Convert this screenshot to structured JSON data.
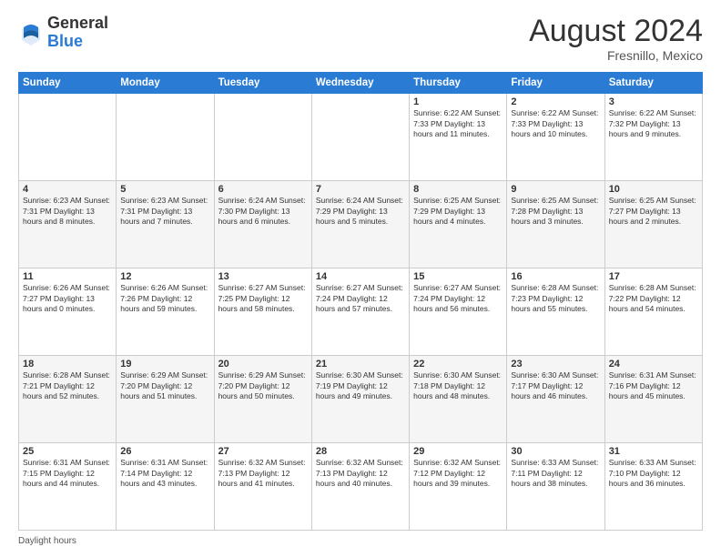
{
  "logo": {
    "general": "General",
    "blue": "Blue"
  },
  "header": {
    "month_year": "August 2024",
    "location": "Fresnillo, Mexico"
  },
  "days_of_week": [
    "Sunday",
    "Monday",
    "Tuesday",
    "Wednesday",
    "Thursday",
    "Friday",
    "Saturday"
  ],
  "footer": {
    "label": "Daylight hours"
  },
  "weeks": [
    [
      {
        "day": "",
        "info": ""
      },
      {
        "day": "",
        "info": ""
      },
      {
        "day": "",
        "info": ""
      },
      {
        "day": "",
        "info": ""
      },
      {
        "day": "1",
        "info": "Sunrise: 6:22 AM\nSunset: 7:33 PM\nDaylight: 13 hours\nand 11 minutes."
      },
      {
        "day": "2",
        "info": "Sunrise: 6:22 AM\nSunset: 7:33 PM\nDaylight: 13 hours\nand 10 minutes."
      },
      {
        "day": "3",
        "info": "Sunrise: 6:22 AM\nSunset: 7:32 PM\nDaylight: 13 hours\nand 9 minutes."
      }
    ],
    [
      {
        "day": "4",
        "info": "Sunrise: 6:23 AM\nSunset: 7:31 PM\nDaylight: 13 hours\nand 8 minutes."
      },
      {
        "day": "5",
        "info": "Sunrise: 6:23 AM\nSunset: 7:31 PM\nDaylight: 13 hours\nand 7 minutes."
      },
      {
        "day": "6",
        "info": "Sunrise: 6:24 AM\nSunset: 7:30 PM\nDaylight: 13 hours\nand 6 minutes."
      },
      {
        "day": "7",
        "info": "Sunrise: 6:24 AM\nSunset: 7:29 PM\nDaylight: 13 hours\nand 5 minutes."
      },
      {
        "day": "8",
        "info": "Sunrise: 6:25 AM\nSunset: 7:29 PM\nDaylight: 13 hours\nand 4 minutes."
      },
      {
        "day": "9",
        "info": "Sunrise: 6:25 AM\nSunset: 7:28 PM\nDaylight: 13 hours\nand 3 minutes."
      },
      {
        "day": "10",
        "info": "Sunrise: 6:25 AM\nSunset: 7:27 PM\nDaylight: 13 hours\nand 2 minutes."
      }
    ],
    [
      {
        "day": "11",
        "info": "Sunrise: 6:26 AM\nSunset: 7:27 PM\nDaylight: 13 hours\nand 0 minutes."
      },
      {
        "day": "12",
        "info": "Sunrise: 6:26 AM\nSunset: 7:26 PM\nDaylight: 12 hours\nand 59 minutes."
      },
      {
        "day": "13",
        "info": "Sunrise: 6:27 AM\nSunset: 7:25 PM\nDaylight: 12 hours\nand 58 minutes."
      },
      {
        "day": "14",
        "info": "Sunrise: 6:27 AM\nSunset: 7:24 PM\nDaylight: 12 hours\nand 57 minutes."
      },
      {
        "day": "15",
        "info": "Sunrise: 6:27 AM\nSunset: 7:24 PM\nDaylight: 12 hours\nand 56 minutes."
      },
      {
        "day": "16",
        "info": "Sunrise: 6:28 AM\nSunset: 7:23 PM\nDaylight: 12 hours\nand 55 minutes."
      },
      {
        "day": "17",
        "info": "Sunrise: 6:28 AM\nSunset: 7:22 PM\nDaylight: 12 hours\nand 54 minutes."
      }
    ],
    [
      {
        "day": "18",
        "info": "Sunrise: 6:28 AM\nSunset: 7:21 PM\nDaylight: 12 hours\nand 52 minutes."
      },
      {
        "day": "19",
        "info": "Sunrise: 6:29 AM\nSunset: 7:20 PM\nDaylight: 12 hours\nand 51 minutes."
      },
      {
        "day": "20",
        "info": "Sunrise: 6:29 AM\nSunset: 7:20 PM\nDaylight: 12 hours\nand 50 minutes."
      },
      {
        "day": "21",
        "info": "Sunrise: 6:30 AM\nSunset: 7:19 PM\nDaylight: 12 hours\nand 49 minutes."
      },
      {
        "day": "22",
        "info": "Sunrise: 6:30 AM\nSunset: 7:18 PM\nDaylight: 12 hours\nand 48 minutes."
      },
      {
        "day": "23",
        "info": "Sunrise: 6:30 AM\nSunset: 7:17 PM\nDaylight: 12 hours\nand 46 minutes."
      },
      {
        "day": "24",
        "info": "Sunrise: 6:31 AM\nSunset: 7:16 PM\nDaylight: 12 hours\nand 45 minutes."
      }
    ],
    [
      {
        "day": "25",
        "info": "Sunrise: 6:31 AM\nSunset: 7:15 PM\nDaylight: 12 hours\nand 44 minutes."
      },
      {
        "day": "26",
        "info": "Sunrise: 6:31 AM\nSunset: 7:14 PM\nDaylight: 12 hours\nand 43 minutes."
      },
      {
        "day": "27",
        "info": "Sunrise: 6:32 AM\nSunset: 7:13 PM\nDaylight: 12 hours\nand 41 minutes."
      },
      {
        "day": "28",
        "info": "Sunrise: 6:32 AM\nSunset: 7:13 PM\nDaylight: 12 hours\nand 40 minutes."
      },
      {
        "day": "29",
        "info": "Sunrise: 6:32 AM\nSunset: 7:12 PM\nDaylight: 12 hours\nand 39 minutes."
      },
      {
        "day": "30",
        "info": "Sunrise: 6:33 AM\nSunset: 7:11 PM\nDaylight: 12 hours\nand 38 minutes."
      },
      {
        "day": "31",
        "info": "Sunrise: 6:33 AM\nSunset: 7:10 PM\nDaylight: 12 hours\nand 36 minutes."
      }
    ]
  ]
}
